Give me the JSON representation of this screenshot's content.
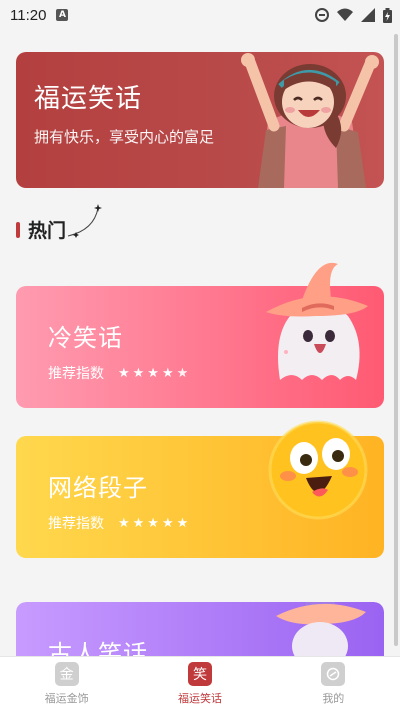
{
  "status": {
    "time": "11:20",
    "a_badge": "A"
  },
  "banner": {
    "title": "福运笑话",
    "subtitle": "拥有快乐，享受内心的富足"
  },
  "section": {
    "title": "热门"
  },
  "cards": [
    {
      "title": "冷笑话",
      "rate_label": "推荐指数",
      "stars": "★★★★",
      "rating": 4.5,
      "color_from": "#ff9bb0",
      "color_to": "#ff5a73"
    },
    {
      "title": "网络段子",
      "rate_label": "推荐指数",
      "stars": "★★★★★",
      "rating": 5,
      "color_from": "#ffd84d",
      "color_to": "#ffb323"
    },
    {
      "title": "古人笑话",
      "color_from": "#c79bff",
      "color_to": "#9a63f2"
    }
  ],
  "tabs": [
    {
      "label": "福运金饰",
      "icon": "金",
      "icon_name": "gold-icon"
    },
    {
      "label": "福运笑话",
      "icon": "笑",
      "icon_name": "joke-icon"
    },
    {
      "label": "我的",
      "icon": "",
      "icon_name": "profile-icon"
    }
  ],
  "colors": {
    "accent": "#c0393b",
    "banner": "#b3403f"
  }
}
